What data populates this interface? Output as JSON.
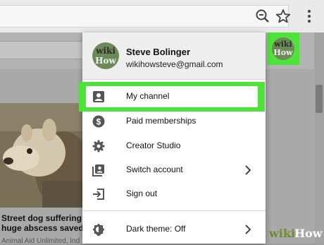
{
  "colors": {
    "highlight": "#4fe23a",
    "menu_bg": "#ffffff",
    "header_bg": "#eeeeee",
    "wikihow_green": "#6c8d2f"
  },
  "browser": {
    "zoom_icon": "zoom-out-icon",
    "star_icon": "star-icon",
    "menu_icon": "kebab-menu-icon"
  },
  "account": {
    "name": "Steve Bolinger",
    "email": "wikihowsteve@gmail.com",
    "avatar_word1": "wiki",
    "avatar_word2": "How"
  },
  "menu": {
    "items": [
      {
        "label": "My channel",
        "icon": "person-icon"
      },
      {
        "label": "Paid memberships",
        "icon": "dollar-icon"
      },
      {
        "label": "Creator Studio",
        "icon": "gear-icon"
      },
      {
        "label": "Switch account",
        "icon": "switch-account-icon"
      },
      {
        "label": "Sign out",
        "icon": "sign-out-icon"
      },
      {
        "label": "Dark theme: Off",
        "icon": "dark-theme-icon"
      }
    ]
  },
  "video": {
    "title_line1": "Street dog suffering fr",
    "title_line2": "huge abscess saved!",
    "channel": "Animal Aid Unlimited, Ind"
  },
  "watermark": {
    "part1": "wiki",
    "part2": "How"
  }
}
